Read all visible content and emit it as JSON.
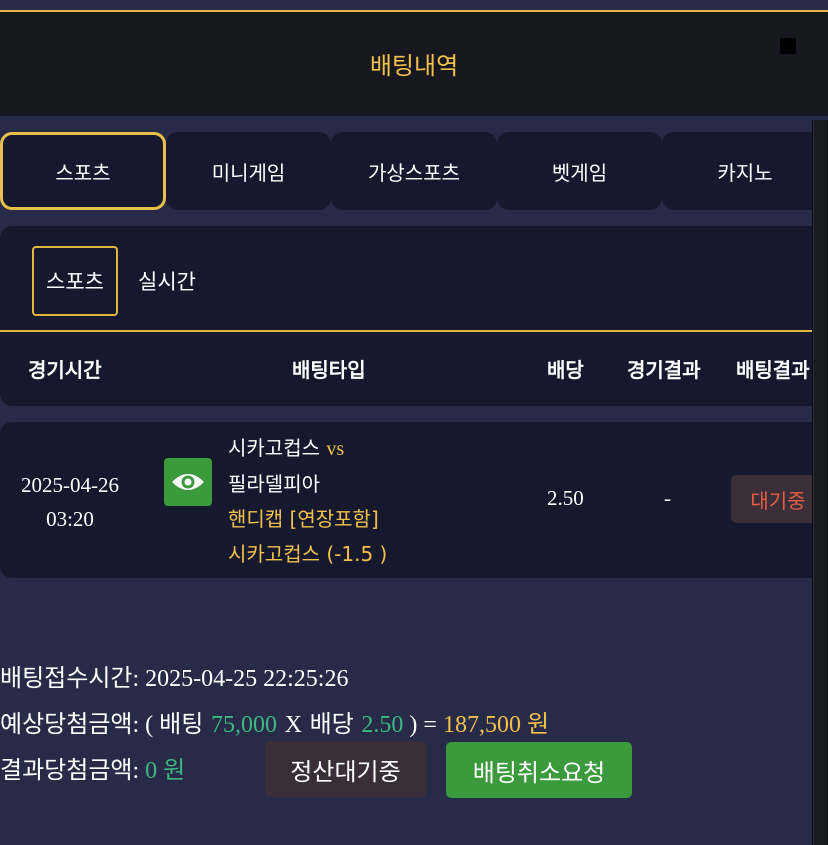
{
  "header": {
    "title": "배팅내역"
  },
  "tabs": [
    {
      "label": "스포츠"
    },
    {
      "label": "미니게임"
    },
    {
      "label": "가상스포츠"
    },
    {
      "label": "벳게임"
    },
    {
      "label": "카지노"
    }
  ],
  "subtabs": [
    {
      "label": "스포츠"
    },
    {
      "label": "실시간"
    }
  ],
  "table": {
    "headers": [
      "경기시간",
      "배팅타입",
      "배당",
      "경기결과",
      "배팅결과"
    ]
  },
  "bet": {
    "date": "2025-04-26",
    "time": "03:20",
    "home": "시카고컵스",
    "vs": "vs",
    "away": "필라델피아",
    "market": "핸디캡 [연장포함]",
    "pick": "시카고컵스 (-1.5 )",
    "odds": "2.50",
    "game_result": "-",
    "bet_result": "대기중"
  },
  "summary": {
    "accept_label": "배팅접수시간",
    "accept_time": "2025-04-25 22:25:26",
    "expected_label": "예상당첨금액",
    "bet_word": "배팅",
    "bet_amount": "75,000",
    "x_word": "X",
    "odds_word": "배당",
    "odds_value": "2.50",
    "payout": "187,500 원",
    "result_label": "결과당첨금액",
    "result_amount": "0 원"
  },
  "buttons": {
    "settle_pending": "정산대기중",
    "cancel_request": "배팅취소요청"
  },
  "colors": {
    "accent": "#e3b641",
    "gold_text": "#f2c04a",
    "green_text": "#3db880",
    "pending_red": "#e75b45",
    "cancel_button": "#3b9a3c"
  }
}
